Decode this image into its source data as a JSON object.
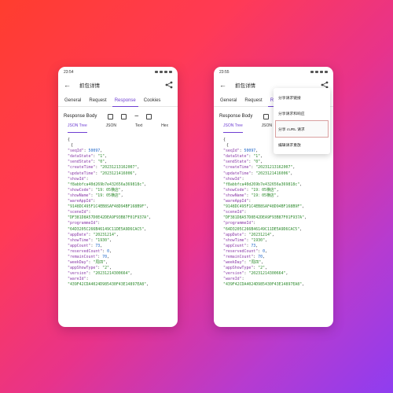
{
  "phones": [
    {
      "time": "23:54",
      "title": "抓包详情",
      "tabs": [
        "General",
        "Request",
        "Response",
        "Cookies"
      ],
      "active_tab": 2,
      "body_title": "Response Body",
      "subtabs": [
        "JSON Tree",
        "JSON",
        "Text",
        "Hex"
      ],
      "menu": null
    },
    {
      "time": "23:55",
      "title": "抓包详情",
      "tabs": [
        "General",
        "Request",
        "Response"
      ],
      "active_tab": 2,
      "body_title": "Response Body",
      "subtabs": [
        "JSON Tree",
        "JSON",
        "Text",
        "Hex"
      ],
      "menu": [
        "分享请求链接",
        "分享请求和响应",
        "分享 cURL 请求",
        "编辑请求重放"
      ]
    }
  ],
  "json_lines": [
    [
      "{"
    ],
    [
      "{"
    ],
    [
      "\"seqId\"",
      ": ",
      "50097",
      ","
    ],
    [
      "\"dataState\"",
      ": ",
      "\"1\"",
      ","
    ],
    [
      "\"sendState\"",
      ": ",
      "\"0\"",
      ","
    ],
    [
      "\"createTime\"",
      ": ",
      "\"20231213162007\"",
      ","
    ],
    [
      "\"updateTime\"",
      ": ",
      "\"2023121416006\"",
      ","
    ],
    [
      "\"showId\"",
      ":",
      "",
      ""
    ],
    [
      "",
      "",
      "\"f8abbfca40d269b7e432656a369818c\"",
      ","
    ],
    [
      "\"showCode\"",
      ": ",
      "\"19：05横店\"",
      ","
    ],
    [
      "\"showName\"",
      ": ",
      "\"19：05横店\"",
      ","
    ],
    [
      "\"wareAppId\"",
      ":",
      "",
      ""
    ],
    [
      "",
      "",
      "\"9148DC495F1C4EB8SAF48D94BF168B9F\"",
      ","
    ],
    [
      "\"sceneId\"",
      ":",
      "",
      ""
    ],
    [
      "",
      "",
      "\"DF381D8A57D0E42DEA9F93B87F01F937A\"",
      ","
    ],
    [
      "\"programmeId\"",
      ":",
      "",
      ""
    ],
    [
      "",
      "",
      "\"64D3205C266B46149C11DE5A9D6CAC5\"",
      ","
    ],
    [
      "\"appDate\"",
      ": ",
      "\"20231214\"",
      ","
    ],
    [
      "\"showTime\"",
      ": ",
      "\"1930\"",
      ","
    ],
    [
      "\"appCount\"",
      ": ",
      "73",
      ","
    ],
    [
      "\"reservedCount\"",
      ": ",
      "0",
      ","
    ],
    [
      "\"remainCount\"",
      ": ",
      "70",
      ","
    ],
    [
      "\"weekDay\"",
      ": ",
      "\"周四\"",
      ","
    ],
    [
      "\"appShowType\"",
      ": ",
      "\"2\"",
      ","
    ],
    [
      "\"version\"",
      ": ",
      "\"20231214300664\"",
      ","
    ],
    [
      "\"wareId\"",
      ":",
      "",
      ""
    ],
    [
      "",
      "",
      "\"439F42CDA4024D985430F43E14897EA8\"",
      ","
    ]
  ]
}
